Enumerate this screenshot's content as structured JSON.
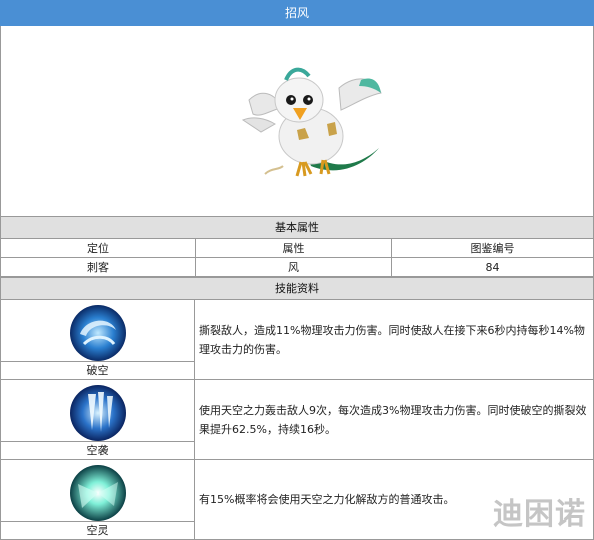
{
  "title": "招风",
  "basic": {
    "header": "基本属性",
    "columns": [
      "定位",
      "属性",
      "图鉴编号"
    ],
    "values": [
      "刺客",
      "风",
      "84"
    ]
  },
  "skills": {
    "header": "技能资料",
    "items": [
      {
        "name": "破空",
        "icon": "wind-vortex-icon",
        "desc": "撕裂敌人，造成11%物理攻击力伤害。同时使敌人在接下来6秒内持每秒14%物理攻击力的伤害。"
      },
      {
        "name": "空袭",
        "icon": "air-raid-icon",
        "desc": "使用天空之力轰击敌人9次，每次造成3%物理攻击力伤害。同时使破空的撕裂效果提升62.5%，持续16秒。"
      },
      {
        "name": "空灵",
        "icon": "ethereal-burst-icon",
        "desc": "有15%概率将会使用天空之力化解敌方的普通攻击。"
      }
    ]
  },
  "watermark": "迪困诺",
  "colors": {
    "title_bg": "#4a8fd4",
    "header_bg": "#e0e0e0",
    "border": "#999999"
  }
}
